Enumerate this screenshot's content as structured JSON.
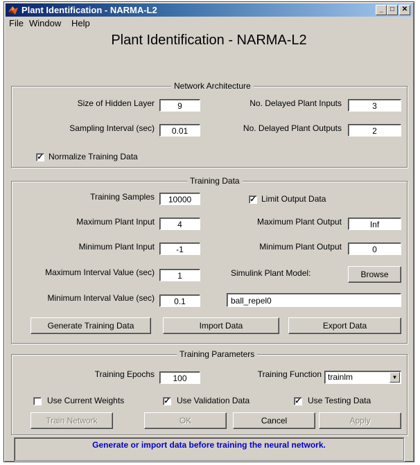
{
  "window": {
    "title": "Plant Identification - NARMA-L2",
    "controls": {
      "minimize": "_",
      "maximize": "□",
      "close": "✕"
    }
  },
  "menu": [
    "File",
    "Window",
    "Help"
  ],
  "main_title": "Plant Identification - NARMA-L2",
  "network_architecture": {
    "title": "Network Architecture",
    "hidden_layer_label": "Size of Hidden Layer",
    "hidden_layer_value": "9",
    "delayed_inputs_label": "No. Delayed Plant Inputs",
    "delayed_inputs_value": "3",
    "sampling_label": "Sampling Interval (sec)",
    "sampling_value": "0.01",
    "delayed_outputs_label": "No. Delayed Plant Outputs",
    "delayed_outputs_value": "2",
    "normalize_label": "Normalize Training Data",
    "normalize_checked": true
  },
  "training_data": {
    "title": "Training Data",
    "samples_label": "Training Samples",
    "samples_value": "10000",
    "limit_output_label": "Limit Output Data",
    "limit_output_checked": true,
    "max_input_label": "Maximum Plant Input",
    "max_input_value": "4",
    "max_output_label": "Maximum Plant Output",
    "max_output_value": "Inf",
    "min_input_label": "Minimum Plant Input",
    "min_input_value": "-1",
    "min_output_label": "Minimum Plant Output",
    "min_output_value": "0",
    "max_interval_label": "Maximum Interval Value (sec)",
    "max_interval_value": "1",
    "simulink_label": "Simulink Plant Model:",
    "browse_label": "Browse",
    "min_interval_label": "Minimum Interval Value (sec)",
    "min_interval_value": "0.1",
    "plant_model_value": "ball_repel0",
    "generate_label": "Generate Training Data",
    "import_label": "Import Data",
    "export_label": "Export Data"
  },
  "training_parameters": {
    "title": "Training Parameters",
    "epochs_label": "Training Epochs",
    "epochs_value": "100",
    "function_label": "Training Function",
    "function_value": "trainlm",
    "current_weights_label": "Use Current Weights",
    "current_weights_checked": false,
    "validation_label": "Use Validation Data",
    "validation_checked": true,
    "testing_label": "Use Testing Data",
    "testing_checked": true
  },
  "actions": {
    "train_label": "Train Network",
    "ok_label": "OK",
    "cancel_label": "Cancel",
    "apply_label": "Apply"
  },
  "status_message": "Generate or import data before training the neural network.",
  "colors": {
    "title_bar": "#0a246a",
    "status_text": "#0000cc",
    "face": "#d4d0c8"
  },
  "icons": {
    "app": "matlab-icon",
    "dropdown": "chevron-down-icon"
  }
}
